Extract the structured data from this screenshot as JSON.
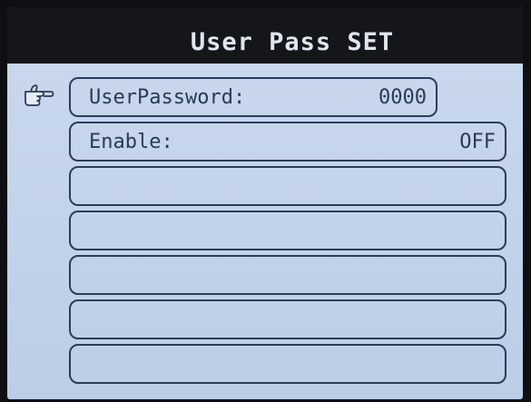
{
  "header": {
    "title": "User Pass SET"
  },
  "cursor": {
    "icon": "pointing-hand-icon"
  },
  "menu": {
    "items": [
      {
        "label": "UserPassword:",
        "value": "0000"
      },
      {
        "label": "Enable:",
        "value": "OFF"
      },
      {
        "label": "",
        "value": ""
      },
      {
        "label": "",
        "value": ""
      },
      {
        "label": "",
        "value": ""
      },
      {
        "label": "",
        "value": ""
      },
      {
        "label": "",
        "value": ""
      }
    ]
  },
  "colors": {
    "screen_bg": "#c7d6ec",
    "titlebar_bg": "#14161a",
    "title_text": "#dfe6f0",
    "row_border": "#2c3c58",
    "row_text": "#2a3a55"
  }
}
